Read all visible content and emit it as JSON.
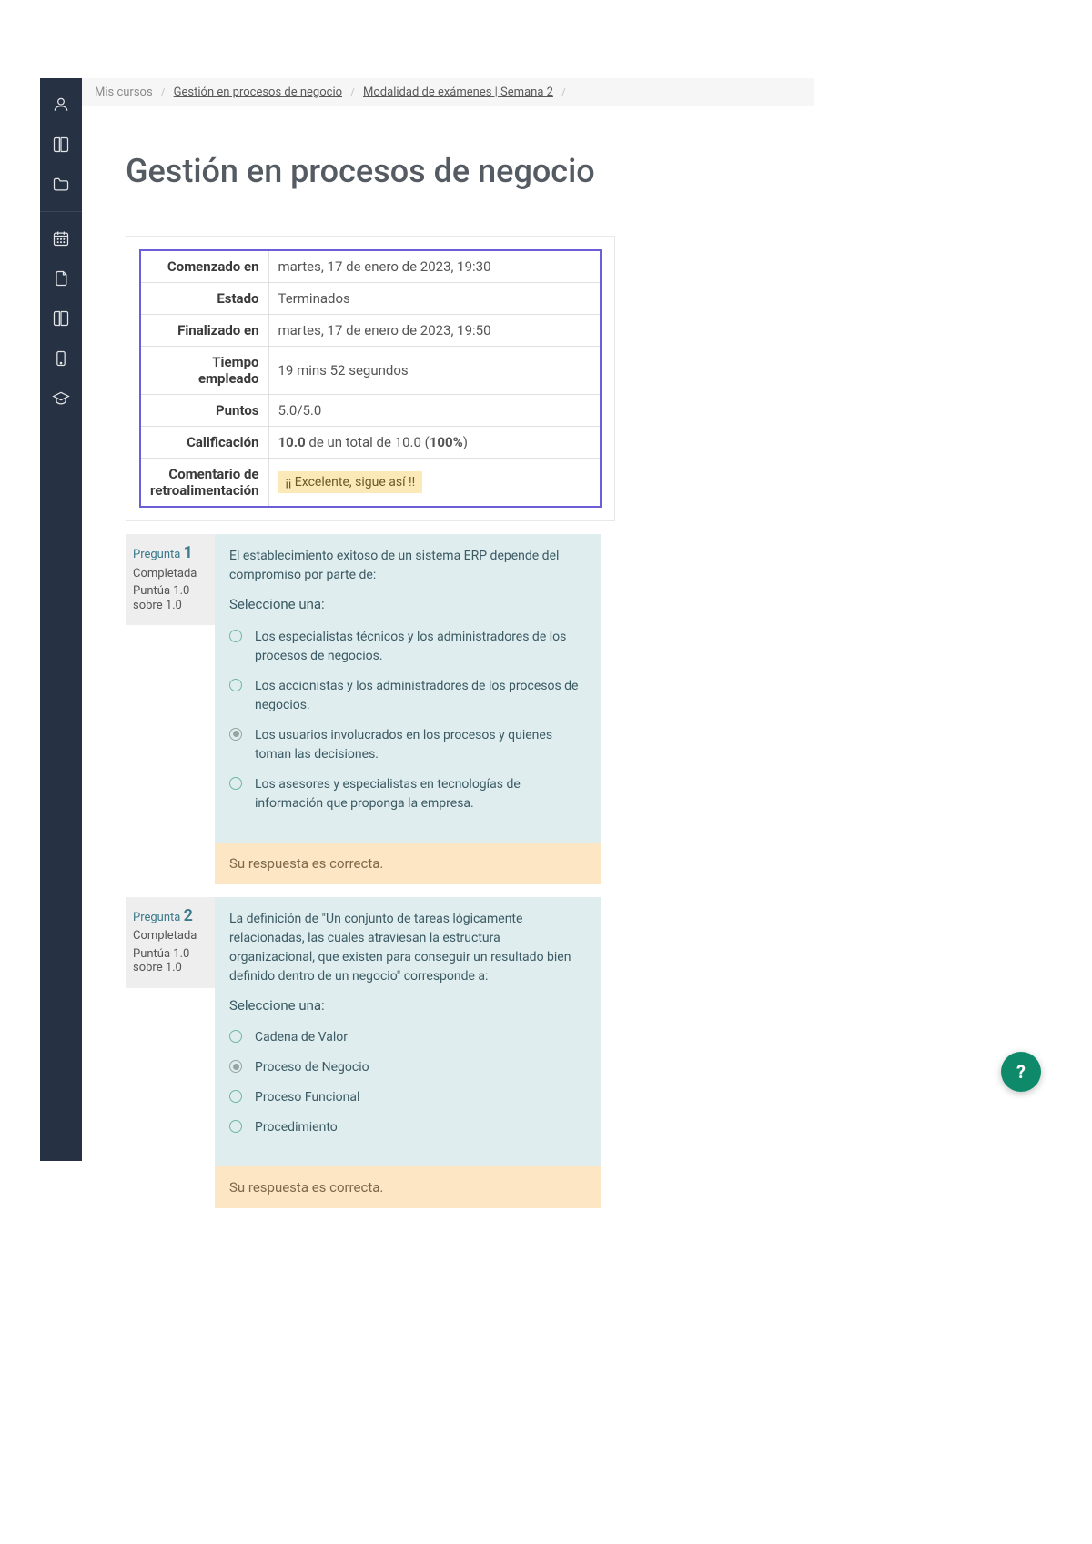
{
  "breadcrumb": {
    "root": "Mis cursos",
    "course": "Gestión en procesos de negocio",
    "section": "Modalidad de exámenes | Semana 2"
  },
  "page_title": "Gestión en procesos de negocio",
  "summary": {
    "labels": {
      "started": "Comenzado en",
      "state": "Estado",
      "completed": "Finalizado en",
      "time": "Tiempo empleado",
      "points": "Puntos",
      "grade": "Calificación",
      "feedback": "Comentario de retroalimentación"
    },
    "values": {
      "started": "martes, 17 de enero de 2023, 19:30",
      "state": "Terminados",
      "completed": "martes, 17 de enero de 2023, 19:50",
      "time": "19 mins 52 segundos",
      "points": "5.0/5.0",
      "grade_strong": "10.0",
      "grade_mid": " de un total de 10.0 (",
      "grade_pct": "100%",
      "grade_close": ")",
      "feedback": "¡¡ Excelente, sigue así !!"
    }
  },
  "question_label": "Pregunta",
  "status_completed": "Completada",
  "score_prefix": "Puntúa 1.0 sobre 1.0",
  "select_one": "Seleccione una:",
  "feedback_correct": "Su respuesta es correcta.",
  "questions": [
    {
      "number": "1",
      "prompt": "El establecimiento exitoso de un sistema ERP depende del compromiso por parte de:",
      "selected_index": 2,
      "options": [
        "Los especialistas técnicos y los administradores de los procesos de negocios.",
        "Los accionistas y los administradores de los procesos de negocios.",
        "Los usuarios involucrados en los procesos y quienes toman las decisiones.",
        "Los asesores y especialistas en tecnologías de información que proponga la empresa."
      ]
    },
    {
      "number": "2",
      "prompt": "La definición de \"Un conjunto de tareas lógicamente relacionadas, las cuales atraviesan la estructura organizacional, que existen para conseguir un resultado bien definido dentro de un negocio\" corresponde a:",
      "selected_index": 1,
      "options": [
        "Cadena de Valor",
        "Proceso de Negocio",
        "Proceso Funcional",
        "Procedimiento"
      ]
    }
  ],
  "help_label": "?"
}
